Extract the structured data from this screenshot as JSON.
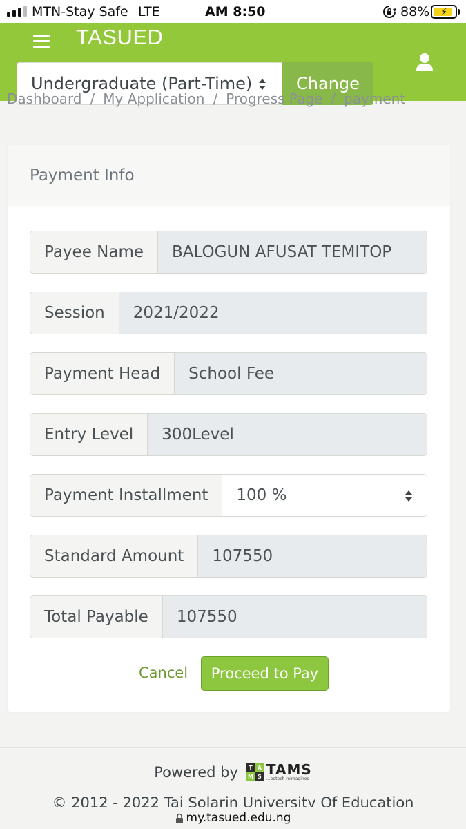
{
  "status_bar": {
    "carrier": "MTN-Stay Safe",
    "network": "LTE",
    "time": "AM 8:50",
    "battery_percent": "88%",
    "battery_level": 0.88
  },
  "header": {
    "brand": "TASUED",
    "program_select": {
      "selected": "Undergraduate (Part-Time)"
    },
    "change_label": "Change",
    "accent_color": "#94c83b"
  },
  "breadcrumb": [
    "Dashboard",
    "My Application",
    "Progress Page",
    "payment"
  ],
  "card": {
    "title": "Payment Info",
    "fields": [
      {
        "label": "Payee Name",
        "value": "BALOGUN AFUSAT TEMITOP"
      },
      {
        "label": "Session",
        "value": "2021/2022"
      },
      {
        "label": "Payment Head",
        "value": "School Fee"
      },
      {
        "label": "Entry Level",
        "value": "300Level"
      },
      {
        "label": "Payment Installment",
        "value": "100 %"
      },
      {
        "label": "Standard Amount",
        "value": "107550"
      },
      {
        "label": "Total Payable",
        "value": "107550"
      }
    ],
    "cancel_label": "Cancel",
    "proceed_label": "Proceed to Pay"
  },
  "footer": {
    "powered_by": "Powered by",
    "logo_text": "TAMS",
    "logo_tagline": "...edtech reimagined",
    "logo_letters": [
      "T",
      "A",
      "M",
      "S"
    ],
    "copyright": "© 2012 - 2022 Tai Solarin University Of Education"
  },
  "url": "my.tasued.edu.ng"
}
